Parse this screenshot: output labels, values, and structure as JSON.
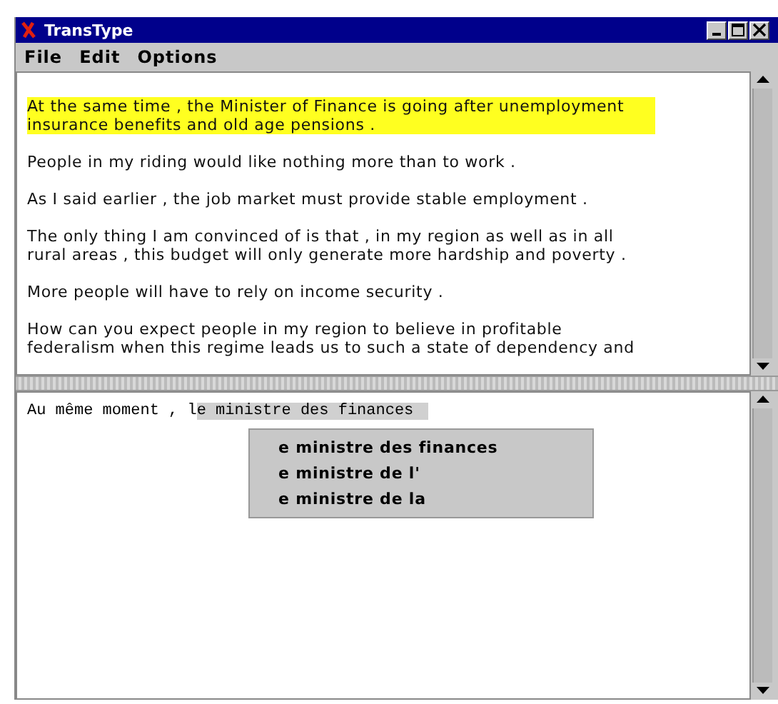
{
  "window": {
    "title": "TransType"
  },
  "menu": [
    "File",
    "Edit",
    "Options"
  ],
  "source_pane": {
    "paragraphs": [
      {
        "text": "At the same time , the Minister of Finance is going after unemployment insurance benefits and old age pensions .",
        "highlighted": true
      },
      {
        "text": "People in my riding would like nothing more than to work .",
        "highlighted": false
      },
      {
        "text": "As I said earlier , the job market must provide stable employment .",
        "highlighted": false
      },
      {
        "text": "The only thing I am convinced of is that , in my region as well as in all rural areas , this budget will only generate more hardship and poverty .",
        "highlighted": false
      },
      {
        "text": "More people will have to rely on income security .",
        "highlighted": false
      },
      {
        "text": "How can you expect people in my region to believe in profitable federalism when this regime leads us to such a state of dependency and",
        "highlighted": false
      }
    ]
  },
  "target_pane": {
    "typed": "Au même moment , l",
    "completion": "e ministre des finances",
    "suggestions": [
      "e ministre des finances",
      "e ministre de l'",
      "e ministre de la"
    ]
  }
}
